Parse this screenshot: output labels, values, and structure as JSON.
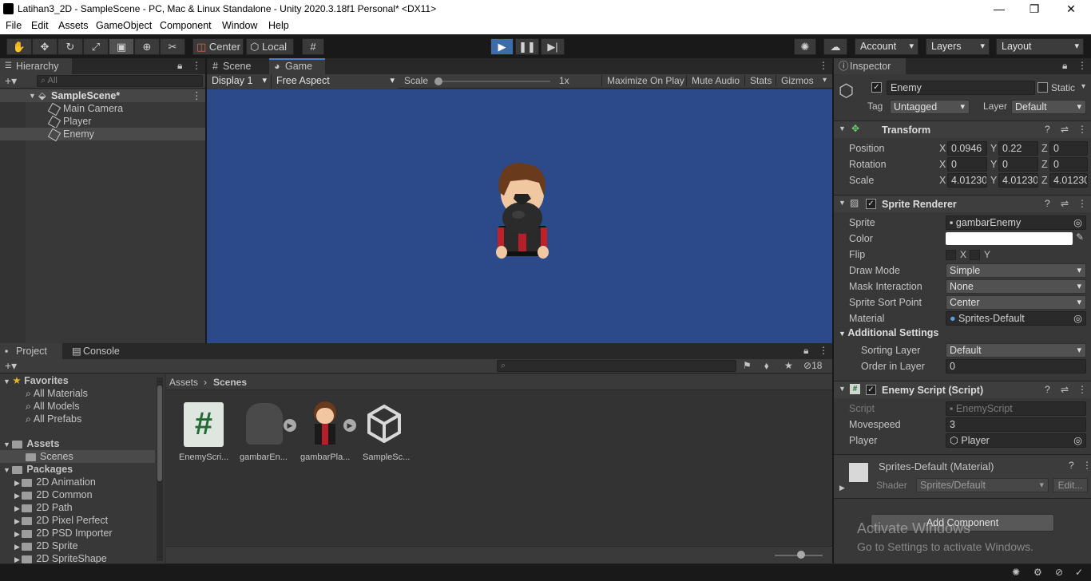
{
  "window": {
    "title": "Latihan3_2D - SampleScene - PC, Mac & Linux Standalone - Unity 2020.3.18f1 Personal* <DX11>",
    "minimize": "—",
    "restore": "❐",
    "close": "✕"
  },
  "menu": [
    "File",
    "Edit",
    "Assets",
    "GameObject",
    "Component",
    "Window",
    "Help"
  ],
  "toolbar": {
    "center": "Center",
    "local": "Local",
    "account": "Account",
    "layers": "Layers",
    "layout": "Layout"
  },
  "hierarchy": {
    "tab": "Hierarchy",
    "search_placeholder": "All",
    "scene": "SampleScene*",
    "items": [
      "Main Camera",
      "Player",
      "Enemy"
    ]
  },
  "game_view": {
    "tabs": [
      "Scene",
      "Game"
    ],
    "display": "Display 1",
    "aspect": "Free Aspect",
    "scale_label": "Scale",
    "scale_value": "1x",
    "maximize": "Maximize On Play",
    "mute": "Mute Audio",
    "stats": "Stats",
    "gizmos": "Gizmos",
    "bg_color": "#2c4a8a"
  },
  "project": {
    "tabs": [
      "Project",
      "Console"
    ],
    "hidden_count": "18",
    "favorites": "Favorites",
    "favorite_items": [
      "All Materials",
      "All Models",
      "All Prefabs"
    ],
    "assets": "Assets",
    "scenes": "Scenes",
    "packages": "Packages",
    "package_items": [
      "2D Animation",
      "2D Common",
      "2D Path",
      "2D Pixel Perfect",
      "2D PSD Importer",
      "2D Sprite",
      "2D SpriteShape"
    ],
    "breadcrumb": [
      "Assets",
      "Scenes"
    ],
    "files": [
      "EnemyScri...",
      "gambarEn...",
      "gambarPla...",
      "SampleSc..."
    ]
  },
  "inspector": {
    "tab": "Inspector",
    "name": "Enemy",
    "static": "Static",
    "tag_label": "Tag",
    "tag": "Untagged",
    "layer_label": "Layer",
    "layer": "Default",
    "transform": {
      "title": "Transform",
      "position_label": "Position",
      "rotation_label": "Rotation",
      "scale_label": "Scale",
      "position": [
        "0.0946",
        "0.22",
        "0"
      ],
      "rotation": [
        "0",
        "0",
        "0"
      ],
      "scale": [
        "4.01230",
        "4.01230",
        "4.01230"
      ]
    },
    "sprite_renderer": {
      "title": "Sprite Renderer",
      "sprite_label": "Sprite",
      "sprite": "gambarEnemy",
      "color_label": "Color",
      "flip_label": "Flip",
      "flip_x": "X",
      "flip_y": "Y",
      "draw_mode_label": "Draw Mode",
      "draw_mode": "Simple",
      "mask_label": "Mask Interaction",
      "mask": "None",
      "sort_point_label": "Sprite Sort Point",
      "sort_point": "Center",
      "material_label": "Material",
      "material": "Sprites-Default",
      "additional": "Additional Settings",
      "sorting_layer_label": "Sorting Layer",
      "sorting_layer": "Default",
      "order_label": "Order in Layer",
      "order": "0"
    },
    "script": {
      "title": "Enemy Script (Script)",
      "script_label": "Script",
      "script": "EnemyScript",
      "movespeed_label": "Movespeed",
      "movespeed": "3",
      "player_label": "Player",
      "player": "Player"
    },
    "material": {
      "title": "Sprites-Default (Material)",
      "shader_label": "Shader",
      "shader": "Sprites/Default",
      "edit": "Edit..."
    },
    "add_component": "Add Component"
  },
  "watermark": {
    "line1": "Activate Windows",
    "line2": "Go to Settings to activate Windows."
  }
}
